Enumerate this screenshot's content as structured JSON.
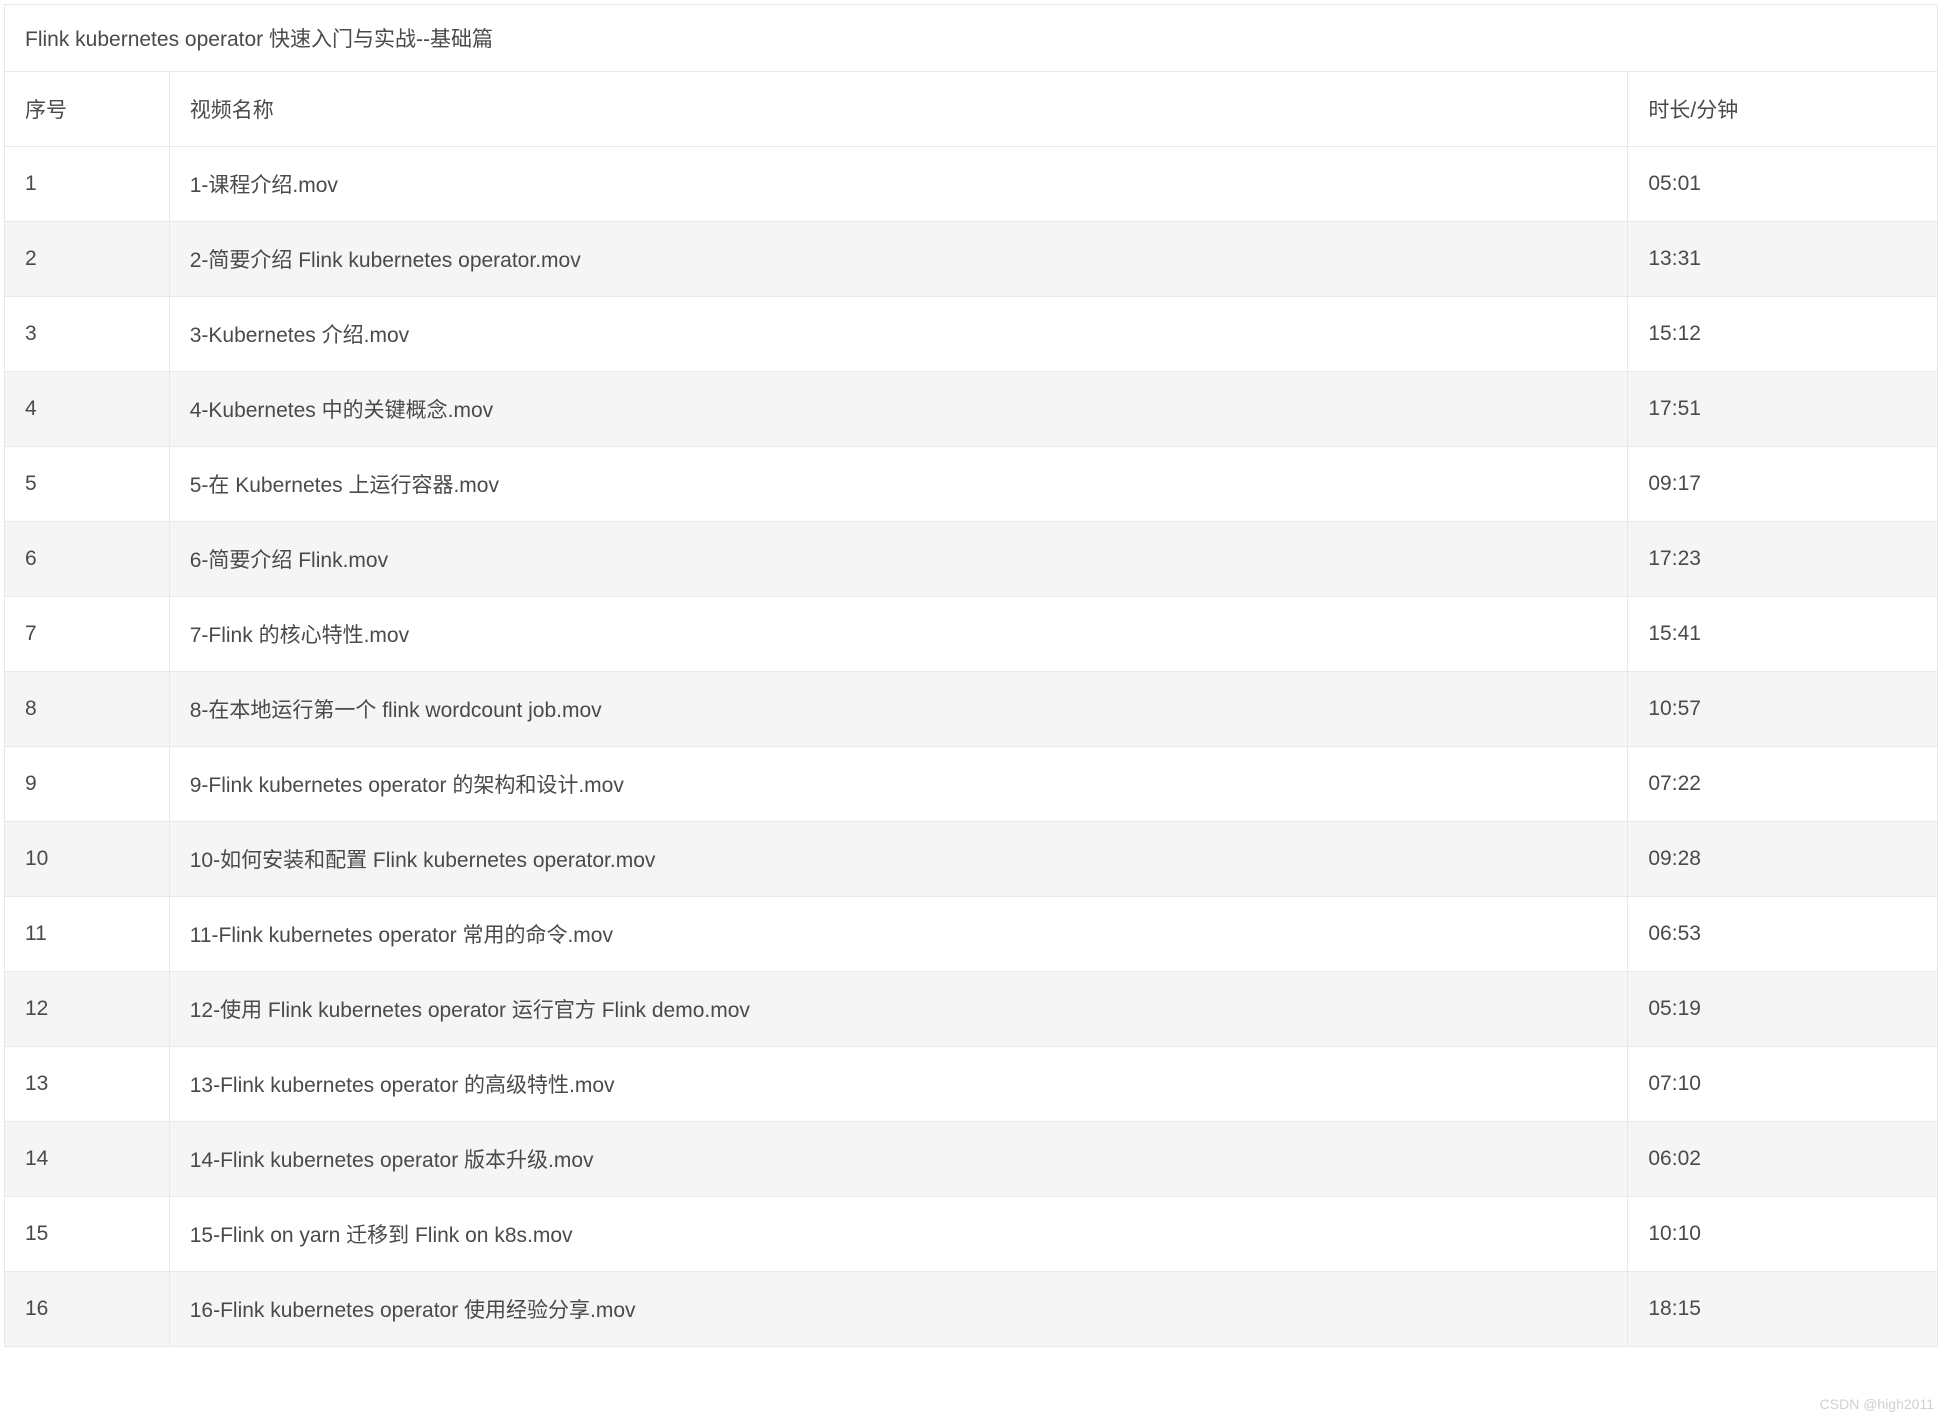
{
  "title": "Flink kubernetes operator 快速入门与实战--基础篇",
  "columns": {
    "index": "序号",
    "name": "视频名称",
    "duration": "时长/分钟"
  },
  "rows": [
    {
      "index": "1",
      "name": "1-课程介绍.mov",
      "duration": "05:01"
    },
    {
      "index": "2",
      "name": "2-简要介绍 Flink kubernetes operator.mov",
      "duration": "13:31"
    },
    {
      "index": "3",
      "name": "3-Kubernetes 介绍.mov",
      "duration": "15:12"
    },
    {
      "index": "4",
      "name": "4-Kubernetes 中的关键概念.mov",
      "duration": "17:51"
    },
    {
      "index": "5",
      "name": "5-在 Kubernetes 上运行容器.mov",
      "duration": "09:17"
    },
    {
      "index": "6",
      "name": "6-简要介绍 Flink.mov",
      "duration": "17:23"
    },
    {
      "index": "7",
      "name": "7-Flink 的核心特性.mov",
      "duration": "15:41"
    },
    {
      "index": "8",
      "name": "8-在本地运行第一个 flink wordcount job.mov",
      "duration": "10:57"
    },
    {
      "index": "9",
      "name": "9-Flink kubernetes operator 的架构和设计.mov",
      "duration": "07:22"
    },
    {
      "index": "10",
      "name": "10-如何安装和配置 Flink kubernetes operator.mov",
      "duration": "09:28"
    },
    {
      "index": "11",
      "name": "11-Flink kubernetes operator 常用的命令.mov",
      "duration": "06:53"
    },
    {
      "index": "12",
      "name": "12-使用 Flink kubernetes operator 运行官方 Flink demo.mov",
      "duration": "05:19"
    },
    {
      "index": "13",
      "name": "13-Flink kubernetes operator 的高级特性.mov",
      "duration": "07:10"
    },
    {
      "index": "14",
      "name": "14-Flink kubernetes operator 版本升级.mov",
      "duration": "06:02"
    },
    {
      "index": "15",
      "name": "15-Flink on yarn 迁移到 Flink on k8s.mov",
      "duration": "10:10"
    },
    {
      "index": "16",
      "name": "16-Flink kubernetes operator 使用经验分享.mov",
      "duration": "18:15"
    }
  ],
  "watermark": "CSDN @high2011"
}
